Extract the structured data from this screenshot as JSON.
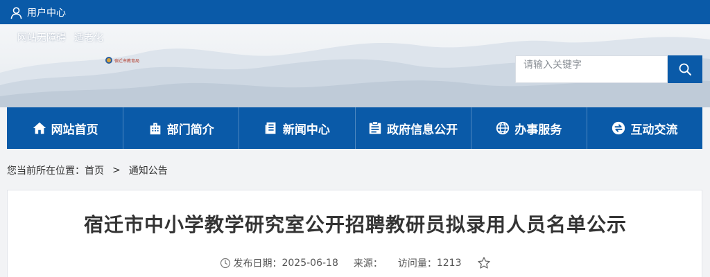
{
  "topbar": {
    "user_center": "用户中心"
  },
  "banner": {
    "accessibility_link": "网站无障碍",
    "elderly_link": "适老化",
    "logo_text": "宿迁市教育局"
  },
  "search": {
    "placeholder": "请输入关键字"
  },
  "nav": {
    "items": [
      {
        "label": "网站首页",
        "icon": "home-icon"
      },
      {
        "label": "部门简介",
        "icon": "building-icon"
      },
      {
        "label": "新闻中心",
        "icon": "news-icon"
      },
      {
        "label": "政府信息公开",
        "icon": "info-icon"
      },
      {
        "label": "办事服务",
        "icon": "globe-icon"
      },
      {
        "label": "互动交流",
        "icon": "exchange-icon"
      }
    ]
  },
  "breadcrumb": {
    "prefix": "您当前所在位置：",
    "home": "首页",
    "separator": ">",
    "current": "通知公告"
  },
  "article": {
    "title": "宿迁市中小学教学研究室公开招聘教研员拟录用人员名单公示",
    "date_label": "发布日期：",
    "date": "2025-06-18",
    "source_label": "来源：",
    "views_label": "访问量：",
    "views": "1213"
  },
  "colors": {
    "primary_blue": "#0a5aa8",
    "page_bg": "#f2f3f5"
  }
}
